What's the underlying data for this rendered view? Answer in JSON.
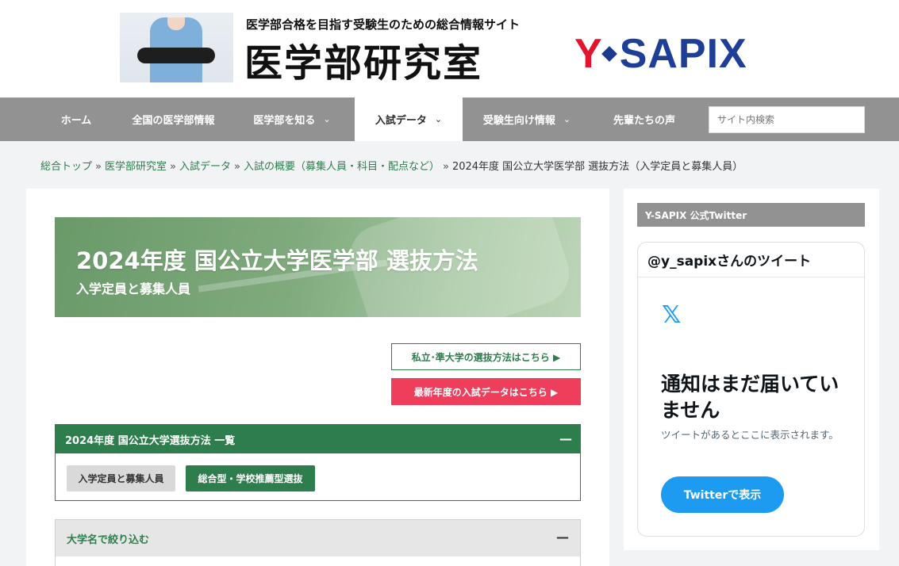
{
  "header": {
    "tagline": "医学部合格を目指す受験生のための総合情報サイト",
    "title": "医学部研究室",
    "brand_left": "Y",
    "brand_right": "SAPIX"
  },
  "nav": {
    "items": [
      {
        "label": "ホーム",
        "has_dropdown": false,
        "active": false
      },
      {
        "label": "全国の医学部情報",
        "has_dropdown": false,
        "active": false
      },
      {
        "label": "医学部を知る",
        "has_dropdown": true,
        "active": false
      },
      {
        "label": "入試データ",
        "has_dropdown": true,
        "active": true
      },
      {
        "label": "受験生向け情報",
        "has_dropdown": true,
        "active": false
      },
      {
        "label": "先輩たちの声",
        "has_dropdown": false,
        "active": false
      }
    ],
    "chevron": "⌄",
    "search_placeholder": "サイト内検索"
  },
  "breadcrumb": {
    "links": [
      "総合トップ",
      "医学部研究室",
      "入試データ",
      "入試の概要（募集人員・科目・配点など）"
    ],
    "separator": "»",
    "current": "2024年度 国公立大学医学部 選抜方法（入学定員と募集人員）"
  },
  "hero": {
    "title": "2024年度 国公立大学医学部 選抜方法",
    "subtitle": "入学定員と募集人員"
  },
  "buttons": {
    "private_link": "私立･準大学の選抜方法はこちら ▶",
    "latest_link": "最新年度の入試データはこちら ▶"
  },
  "accordion_methods": {
    "title": "2024年度 国公立大学選抜方法 一覧",
    "toggle": "—",
    "pills": [
      "入学定員と募集人員",
      "総合型・学校推薦型選抜"
    ]
  },
  "accordion_filter": {
    "title": "大学名で絞り込む",
    "toggle": "—"
  },
  "sidebar": {
    "heading": "Y-SAPIX 公式Twitter",
    "timeline_title": "@y_sapixさんのツイート",
    "x_logo": "𝕏",
    "empty_title": "通知はまだ届いていません",
    "empty_sub": "ツイートがあるとここに表示されます。",
    "view_button": "Twitterで表示"
  },
  "colors": {
    "accent_green": "#2e7d4d",
    "nav_grey": "#929292",
    "cta_red": "#ee3e5b",
    "twitter_blue": "#1d9bf0"
  }
}
